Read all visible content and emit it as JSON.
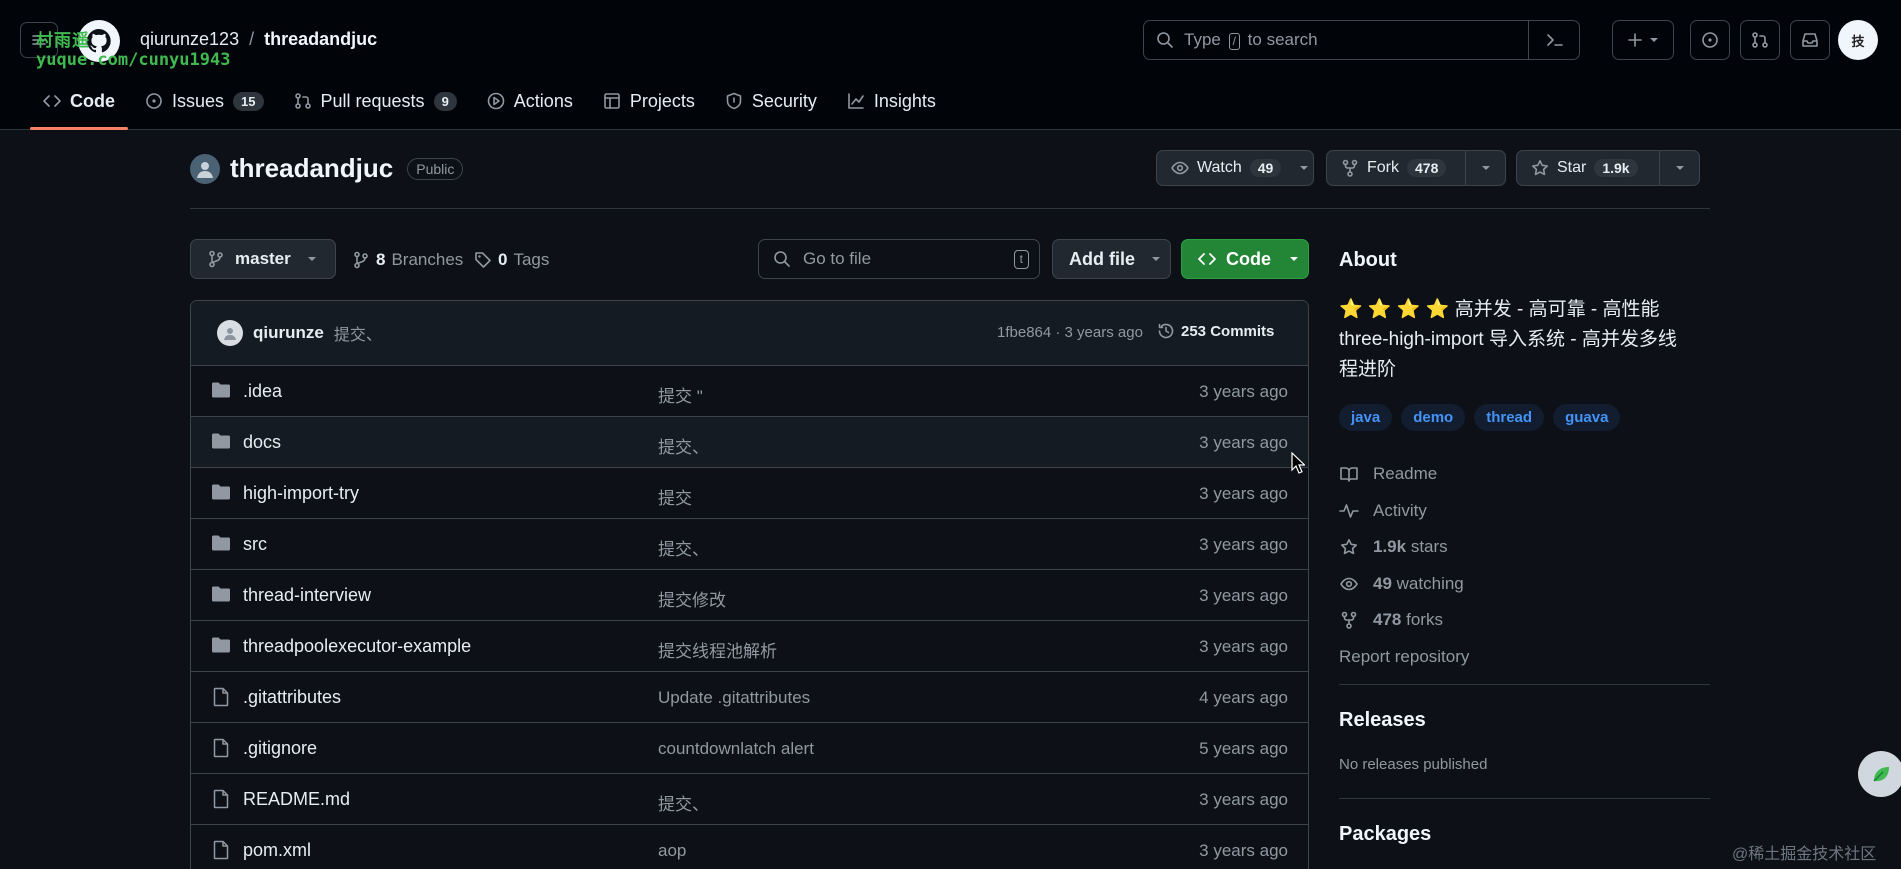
{
  "watermark": {
    "line1": "村雨遥",
    "line2": "yuque.com/cunyu1943"
  },
  "breadcrumb": {
    "owner": "qiurunze123",
    "separator": "/",
    "repo": "threadandjuc"
  },
  "search": {
    "prefix": "Type",
    "key": "/",
    "suffix": "to search"
  },
  "avatar_text": "技",
  "nav": {
    "code": "Code",
    "issues": "Issues",
    "issues_count": "15",
    "pulls": "Pull requests",
    "pulls_count": "9",
    "actions": "Actions",
    "projects": "Projects",
    "security": "Security",
    "insights": "Insights"
  },
  "repo": {
    "name": "threadandjuc",
    "visibility": "Public",
    "watch_label": "Watch",
    "watch_count": "49",
    "fork_label": "Fork",
    "fork_count": "478",
    "star_label": "Star",
    "star_count": "1.9k"
  },
  "controls": {
    "branch": "master",
    "branches_count": "8",
    "branches_label": "Branches",
    "tags_count": "0",
    "tags_label": "Tags",
    "goto_placeholder": "Go to file",
    "goto_key": "t",
    "add_file": "Add file",
    "code": "Code"
  },
  "latest_commit": {
    "author": "qiurunze",
    "message": "提交、",
    "hash_date": "1fbe864 · 3 years ago",
    "commits": "253 Commits"
  },
  "files": [
    {
      "type": "dir",
      "name": ".idea",
      "message": "提交 \"",
      "date": "3 years ago"
    },
    {
      "type": "dir",
      "name": "docs",
      "message": "提交、",
      "date": "3 years ago"
    },
    {
      "type": "dir",
      "name": "high-import-try",
      "message": "提交",
      "date": "3 years ago"
    },
    {
      "type": "dir",
      "name": "src",
      "message": "提交、",
      "date": "3 years ago"
    },
    {
      "type": "dir",
      "name": "thread-interview",
      "message": "提交修改",
      "date": "3 years ago"
    },
    {
      "type": "dir",
      "name": "threadpoolexecutor-example",
      "message": "提交线程池解析",
      "date": "3 years ago"
    },
    {
      "type": "file",
      "name": ".gitattributes",
      "message": "Update .gitattributes",
      "date": "4 years ago"
    },
    {
      "type": "file",
      "name": ".gitignore",
      "message": "countdownlatch alert",
      "date": "5 years ago"
    },
    {
      "type": "file",
      "name": "README.md",
      "message": "提交、",
      "date": "3 years ago"
    },
    {
      "type": "file",
      "name": "pom.xml",
      "message": "aop",
      "date": "3 years ago"
    }
  ],
  "about": {
    "heading": "About",
    "stars_emoji": "⭐ ⭐ ⭐ ⭐",
    "description_line1": "高并发 - 高可靠 - 高性能",
    "description_line2": "three-high-import 导入系统 - 高并发多线",
    "description_line3": "程进阶",
    "topics": [
      "java",
      "demo",
      "thread",
      "guava"
    ],
    "readme": "Readme",
    "activity": "Activity",
    "stars_count": "1.9k",
    "stars_label": "stars",
    "watching_count": "49",
    "watching_label": "watching",
    "forks_count": "478",
    "forks_label": "forks",
    "report": "Report repository"
  },
  "releases": {
    "heading": "Releases",
    "empty": "No releases published"
  },
  "packages": {
    "heading": "Packages"
  },
  "credit": "@稀土掘金技术社区",
  "colors": {
    "bg": "#0d1117",
    "header_bg": "#010409",
    "border": "#3d444d",
    "accent_tab": "#f78166",
    "code_button": "#238636",
    "topic_text": "#4493f8",
    "muted": "#9198a1"
  }
}
